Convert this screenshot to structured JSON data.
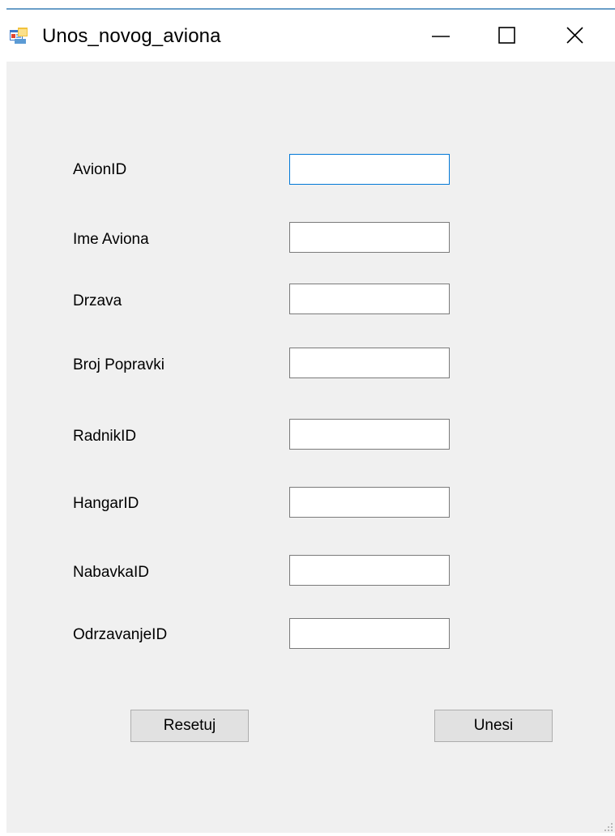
{
  "window": {
    "title": "Unos_novog_aviona",
    "icon": "form-app-icon",
    "controls": [
      "minimize-icon",
      "maximize-icon",
      "close-icon"
    ]
  },
  "form": {
    "fields": [
      {
        "label": "AvionID",
        "value": "",
        "focused": true
      },
      {
        "label": "Ime Aviona",
        "value": ""
      },
      {
        "label": "Drzava",
        "value": ""
      },
      {
        "label": "Broj Popravki",
        "value": ""
      },
      {
        "label": "RadnikID",
        "value": ""
      },
      {
        "label": "HangarID",
        "value": ""
      },
      {
        "label": "NabavkaID",
        "value": ""
      },
      {
        "label": "OdrzavanjeID",
        "value": ""
      }
    ],
    "reset_label": "Resetuj",
    "submit_label": "Unesi"
  },
  "colors": {
    "window_background": "#f0f0f0",
    "focus_border": "#0078d7",
    "input_border": "#7a7a7a",
    "button_background": "#e1e1e1"
  }
}
